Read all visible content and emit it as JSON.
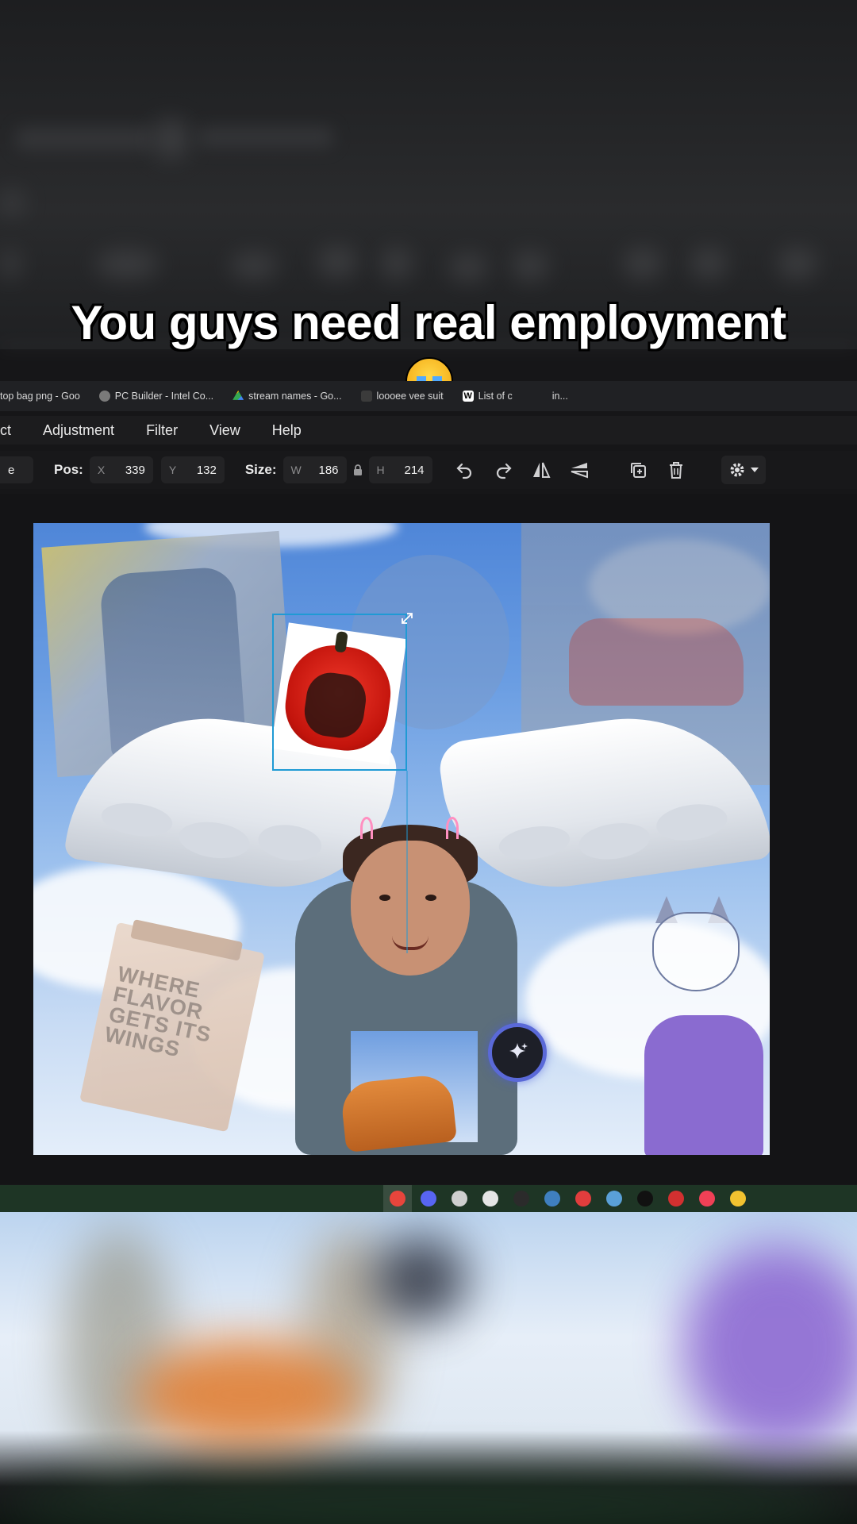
{
  "caption": {
    "text": "You guys need real employment",
    "emoji": "loudly-crying-face"
  },
  "bookmarks": [
    {
      "label": "top bag png - Goo",
      "icon": "google-icon",
      "color": "#4285f4"
    },
    {
      "label": "PC Builder - Intel Co...",
      "icon": "pc-builder-icon",
      "color": "#7a7a7a"
    },
    {
      "label": "stream names - Go...",
      "icon": "drive-icon",
      "color": "#34a853"
    },
    {
      "label": "loooee vee suit",
      "icon": "lv-icon",
      "color": "#3b3b3b"
    },
    {
      "label": "List of c",
      "icon": "wikipedia-icon",
      "color": "#ffffff"
    },
    {
      "label": "in...",
      "icon": "",
      "color": ""
    }
  ],
  "menu": {
    "items": [
      "ct",
      "Adjustment",
      "Filter",
      "View",
      "Help"
    ]
  },
  "toolbar": {
    "left_field": "e",
    "pos_label": "Pos:",
    "x_label": "X",
    "x_value": "339",
    "y_label": "Y",
    "y_value": "132",
    "size_label": "Size:",
    "w_label": "W",
    "w_value": "186",
    "h_label": "H",
    "h_value": "214",
    "icons": [
      "undo-icon",
      "redo-icon",
      "flip-horizontal-icon",
      "flip-vertical-icon",
      "duplicate-icon",
      "delete-icon",
      "settings-icon"
    ]
  },
  "canvas": {
    "bag_text": [
      "WHERE",
      "FLAVOR",
      "GETS ITS",
      "WINGS"
    ],
    "ai_button_icon": "sparkle-icon"
  },
  "taskbar": {
    "icons": [
      {
        "name": "chrome-icon",
        "color": "#e8453c"
      },
      {
        "name": "discord-icon",
        "color": "#5865f2"
      },
      {
        "name": "obs-icon",
        "color": "#cfcfcf"
      },
      {
        "name": "app-icon",
        "color": "#e5e5e5"
      },
      {
        "name": "epic-games-icon",
        "color": "#2b2b2b"
      },
      {
        "name": "editor-icon",
        "color": "#3f7fbf"
      },
      {
        "name": "red-app-icon",
        "color": "#e13d3d"
      },
      {
        "name": "steam-icon",
        "color": "#5aa0d8"
      },
      {
        "name": "github-icon",
        "color": "#111111"
      },
      {
        "name": "red-app-2-icon",
        "color": "#d23030"
      },
      {
        "name": "pocket-icon",
        "color": "#ef4056"
      },
      {
        "name": "file-explorer-icon",
        "color": "#f2c230"
      }
    ]
  }
}
